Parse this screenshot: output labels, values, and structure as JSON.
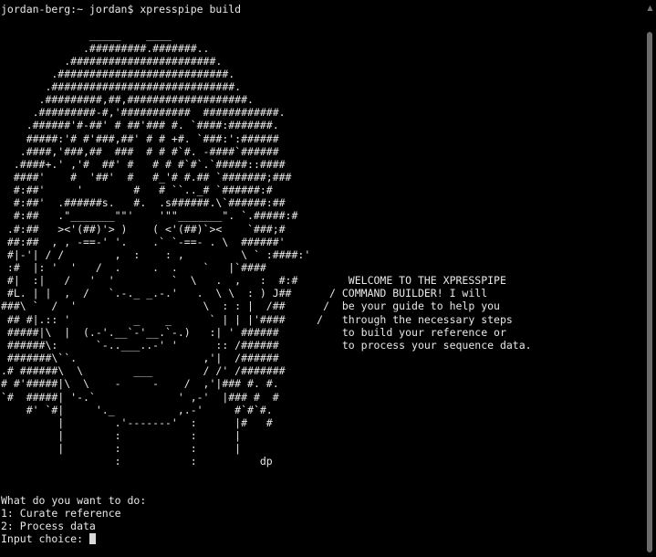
{
  "terminal": {
    "prompt_line": "jordan-berg:~ jordan$ xpresspipe build",
    "art_lines": [
      "              _____    ____",
      "             .#########.#######..",
      "          .#######################.",
      "        .###########################.",
      "       .#############################.",
      "      .#########,##,###################.",
      "     .#########-#,'###########  ############.",
      "    .######'#-##' # ##'### #. `####:#######.",
      "    #####:'# #'###,##' # # +#. `###:':######",
      "   .####,'###,##  ###  # # #`#. -####`######",
      "  .####+.' ,'#  ##' #   # # #`#`.`#####::####",
      "  ####'    #  '##'  #   #_'# #.## `#######;###",
      "  #:##'     '        #   # ``.._# `######:#",
      "  #:##'  .######s.   #.  .s######.\\`######:##",
      "  #:##   .\"_______\"\"'    '\"\"_______\". `.#####:#",
      " .#:##   ><'(##)'> )    ( <'(##)`><    `###;#",
      " ##:##  , , -==-' '.    .` `-==- . \\  ######'",
      " #|-'| / /        ,  :    : ,         \\ ` :####:'",
      " :#  |: '  '   /  .     .  .    `   |`####",
      " #|  :|   /   '  '         `  \\   .  ,   :  #:#        WELCOME TO THE XPRESSPIPE",
      " #L. | |  ,  /   `.-._ _.-.'   .  \\ \\  : ) J##      / COMMAND BUILDER! I will",
      "###\\ `  /  '                    \\  : : |  /##      /  be your guide to help you",
      " ## #|.:: '          _    _      ` | | |'####     /   through the necessary steps",
      " #####|\\  |  (.-'.__`-'__.`-.)   :| ' ######          to build your reference or",
      " ######\\:      `-..___..-' '      :: /######          to process your sequence data.",
      " #######\\``.                    ,'|  /######",
      ".# ######\\  \\        ___        / /' /#######",
      "# #'#####|\\  \\    -     -    /  ,'|### #. #.",
      "`#  #####| '-.`             ' ,-'  |### #  #",
      "    #' `#|     '._          ,.-'     #`#`#.",
      "         |        .'-------'  :      |#   #",
      "         |        :           :      |",
      "         |        :           :      |",
      "                  :           :          dp"
    ],
    "question": "What do you want to do:",
    "options": [
      "1: Curate reference",
      "2: Process data"
    ],
    "input_prompt": "Input choice: "
  }
}
